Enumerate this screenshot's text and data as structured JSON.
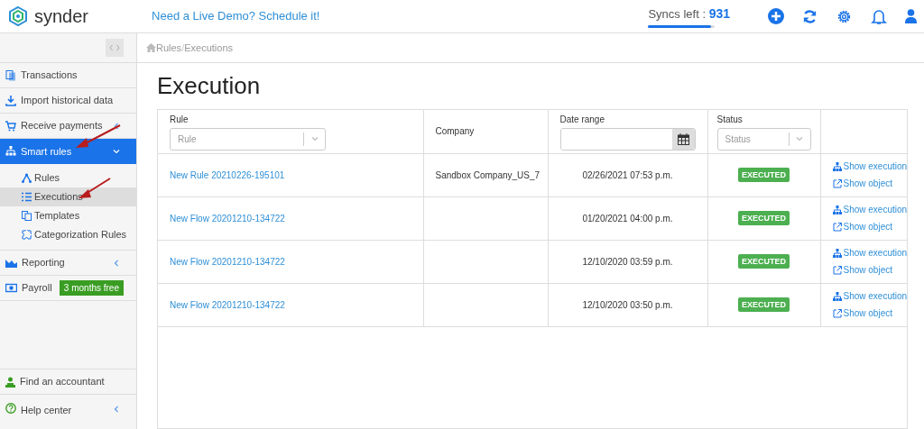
{
  "header": {
    "logo_text": "synder",
    "demo_link": "Need a Live Demo? Schedule it!",
    "syncs_label": "Syncs left : ",
    "syncs_count": "931",
    "syncs_meter": {
      "level": 0.94
    }
  },
  "sidebar": {
    "items": [
      {
        "label": "Transactions",
        "selected": false
      },
      {
        "label": "Import historical data",
        "selected": false
      },
      {
        "label": "Receive payments",
        "selected": false,
        "expanded": false
      },
      {
        "label": "Smart rules",
        "selected": true,
        "expanded": true,
        "children": [
          {
            "label": "Rules",
            "selected": false
          },
          {
            "label": "Executions",
            "selected": true
          },
          {
            "label": "Templates",
            "selected": false
          },
          {
            "label": "Categorization Rules",
            "selected": false
          }
        ]
      },
      {
        "label": "Reporting",
        "selected": false,
        "expanded": false
      },
      {
        "label": "Payroll",
        "selected": false,
        "badge": "3 months free"
      }
    ],
    "bottom_items": [
      {
        "label": "Find an accountant",
        "selected": false
      },
      {
        "label": "Help center",
        "selected": false,
        "expanded": false
      }
    ]
  },
  "breadcrumb": [
    "Rules",
    "Executions"
  ],
  "breadcrumb_separator": "/",
  "title": "Execution",
  "table": {
    "columns": [
      {
        "kind": "select",
        "label": "Rule",
        "placeholder": "Rule"
      },
      {
        "kind": "text",
        "label": "Company"
      },
      {
        "kind": "date",
        "label": "Date range"
      },
      {
        "kind": "select",
        "label": "Status",
        "placeholder": "Status"
      }
    ],
    "rows": [
      {
        "rule": "New Rule 20210226-195101",
        "company": "Sandbox Company_US_7",
        "date": "02/26/2021 07:53 p.m.",
        "status": "EXECUTED",
        "actions": [
          "Show execution",
          "Show object"
        ]
      },
      {
        "rule": "New Flow 20201210-134722",
        "date": "01/20/2021 04:00 p.m.",
        "status": "EXECUTED",
        "actions": [
          "Show execution",
          "Show object"
        ]
      },
      {
        "rule": "New Flow 20201210-134722",
        "date": "12/10/2020 03:59 p.m.",
        "status": "EXECUTED",
        "actions": [
          "Show execution",
          "Show object"
        ]
      },
      {
        "rule": "New Flow 20201210-134722",
        "date": "12/10/2020 03:50 p.m.",
        "status": "EXECUTED",
        "actions": [
          "Show execution",
          "Show object"
        ]
      }
    ]
  }
}
